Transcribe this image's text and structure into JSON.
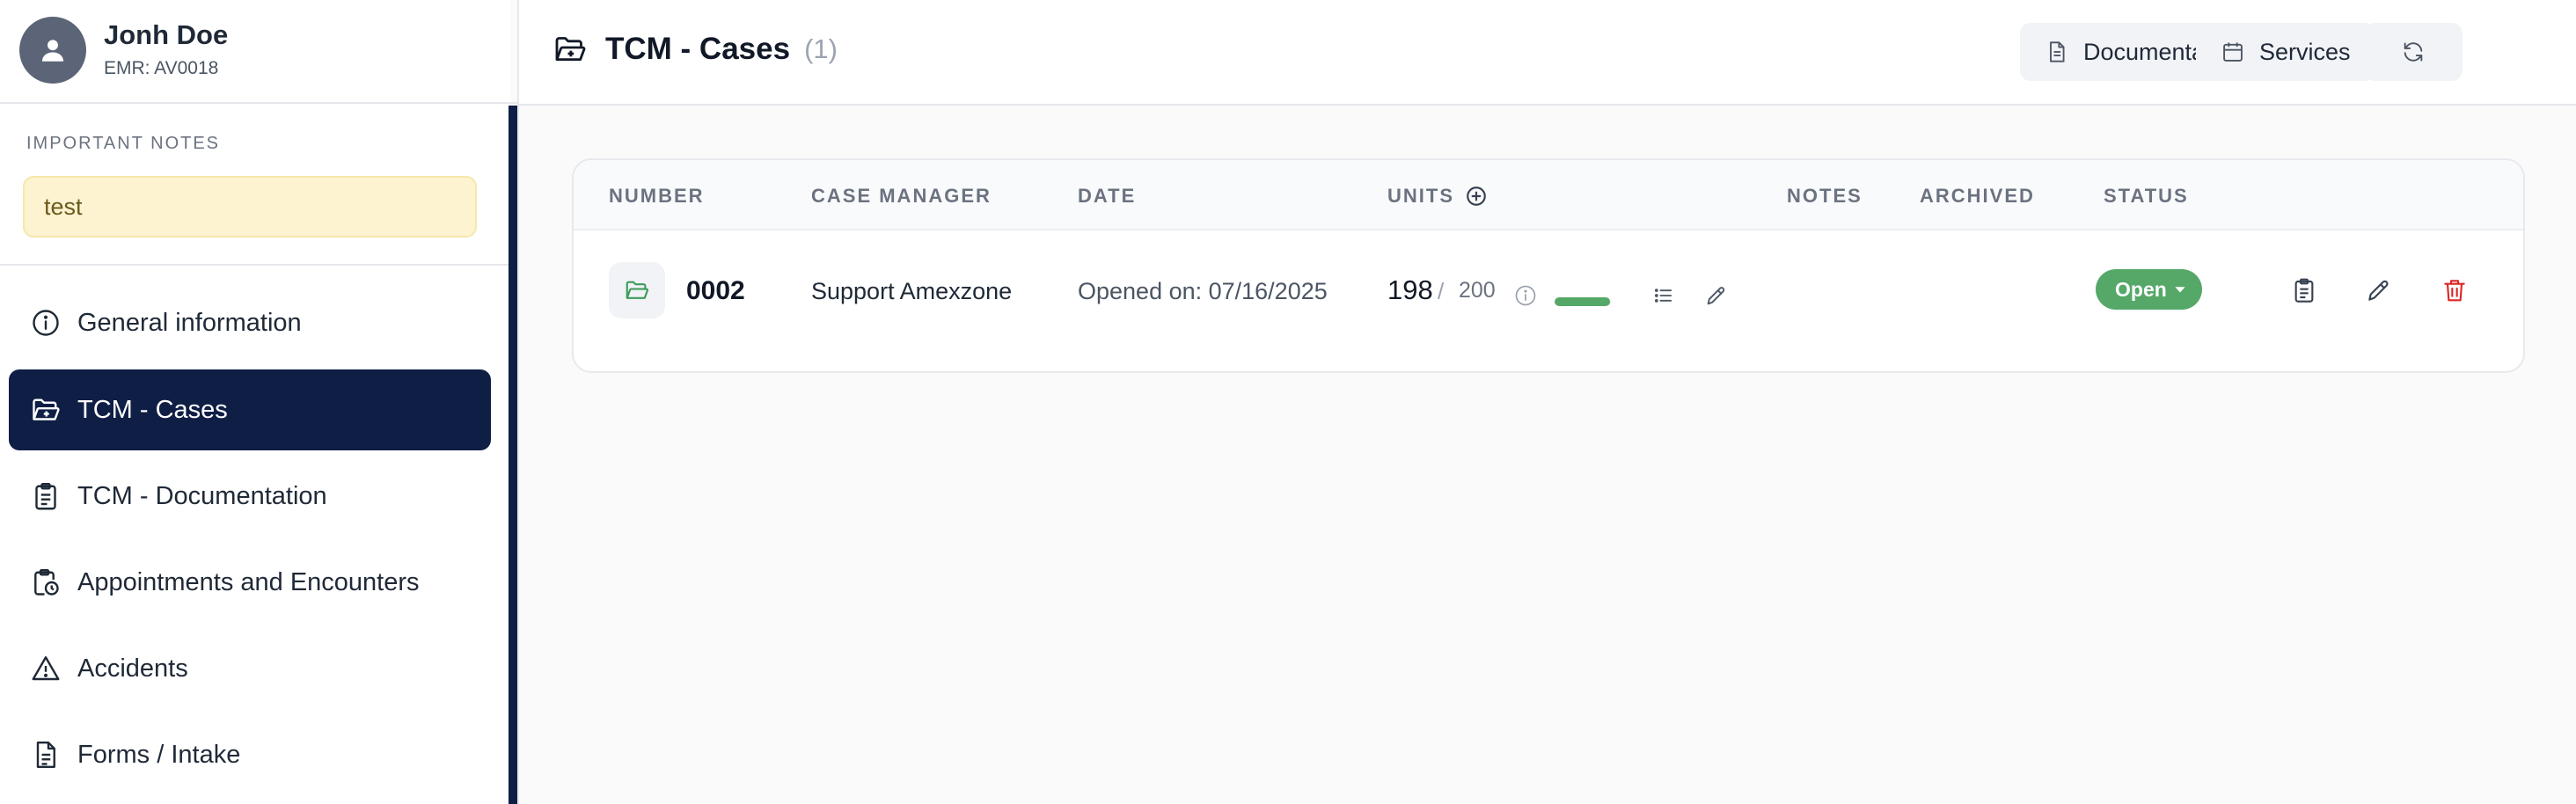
{
  "user": {
    "name": "Jonh Doe",
    "emr": "EMR: AV0018"
  },
  "notes": {
    "title": "IMPORTANT NOTES",
    "items": [
      "test"
    ]
  },
  "nav": {
    "items": [
      {
        "label": "General information",
        "icon": "info-icon"
      },
      {
        "label": "TCM - Cases",
        "icon": "folder-open-icon",
        "active": true
      },
      {
        "label": "TCM - Documentation",
        "icon": "clipboard-icon"
      },
      {
        "label": "Appointments and Encounters",
        "icon": "calendar-clock-icon"
      },
      {
        "label": "Accidents",
        "icon": "warning-icon"
      },
      {
        "label": "Forms / Intake",
        "icon": "document-icon"
      }
    ]
  },
  "header": {
    "title": "TCM - Cases",
    "count": "(1)",
    "buttons": {
      "documentation": "Documentation",
      "services": "Services"
    }
  },
  "table": {
    "columns": {
      "number": "NUMBER",
      "case_manager": "CASE MANAGER",
      "date": "DATE",
      "units": "UNITS",
      "notes": "NOTES",
      "archived": "ARCHIVED",
      "status": "STATUS"
    },
    "rows": [
      {
        "number": "0002",
        "case_manager": "Support Amexzone",
        "date": "Opened on: 07/16/2025",
        "units_used": "198",
        "units_separator": "/",
        "units_total": "200",
        "units_fraction": 0.99,
        "notes": "",
        "archived": "",
        "status": "Open"
      }
    ]
  },
  "colors": {
    "nav_active": "#0f1e45",
    "success": "#55a868",
    "danger": "#dc2626",
    "note_bg": "#fdf3d0"
  }
}
